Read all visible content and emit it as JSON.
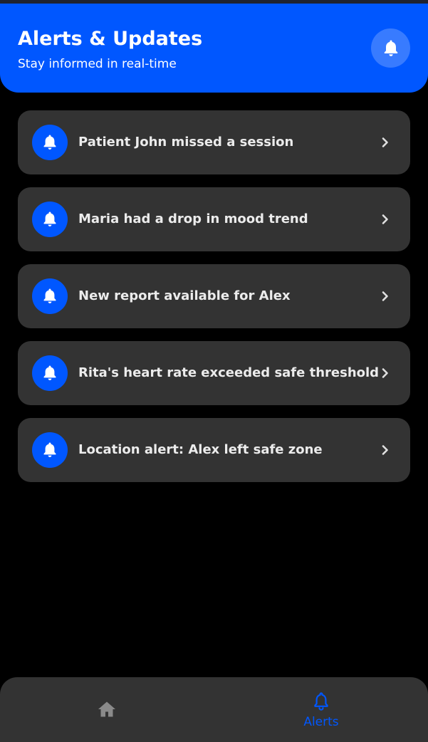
{
  "header": {
    "title": "Alerts & Updates",
    "subtitle": "Stay informed in real-time",
    "icon": "bell-icon"
  },
  "alerts": [
    {
      "text": "Patient John missed a session",
      "icon": "bell-icon"
    },
    {
      "text": "Maria had a drop in mood trend",
      "icon": "bell-icon"
    },
    {
      "text": "New report available for Alex",
      "icon": "bell-icon"
    },
    {
      "text": "Rita's heart rate exceeded safe threshold",
      "icon": "bell-icon"
    },
    {
      "text": "Location alert: Alex left safe zone",
      "icon": "bell-icon"
    }
  ],
  "bottom_nav": {
    "items": [
      {
        "icon": "home-icon",
        "label": "",
        "active": false
      },
      {
        "icon": "bell-icon",
        "label": "Alerts",
        "active": true
      }
    ]
  },
  "colors": {
    "accent": "#0057ff",
    "background": "#000000",
    "card": "#333333",
    "text": "#ececec",
    "inactive_icon": "#8a8a8a"
  }
}
